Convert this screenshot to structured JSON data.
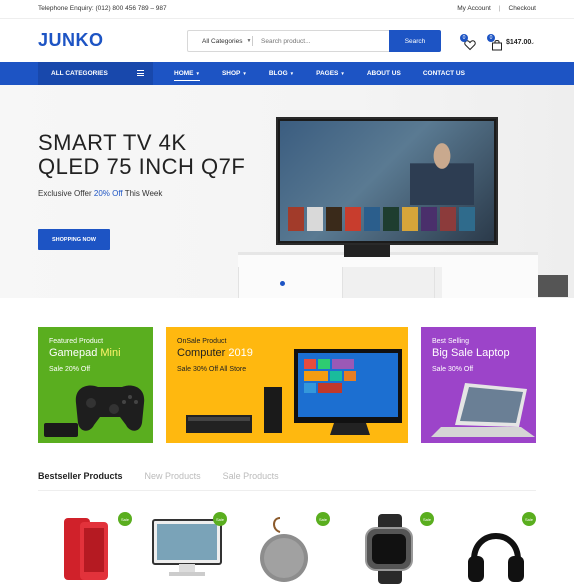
{
  "topbar": {
    "enquiry": "Telephone Enquiry: (012) 800 456 789 – 987",
    "my_account": "My Account",
    "separator": "|",
    "checkout": "Checkout"
  },
  "header": {
    "logo": "JUNKO",
    "category_select": "All Categories",
    "search_placeholder": "Search product...",
    "search_button": "Search",
    "wishlist_count": "0",
    "cart_count": "0",
    "cart_total": "$147.00"
  },
  "nav": {
    "all_categories": "ALL CATEGORIES",
    "items": [
      {
        "label": "HOME",
        "has_dropdown": true,
        "active": true
      },
      {
        "label": "SHOP",
        "has_dropdown": true
      },
      {
        "label": "BLOG",
        "has_dropdown": true
      },
      {
        "label": "PAGES",
        "has_dropdown": true
      },
      {
        "label": "ABOUT US"
      },
      {
        "label": "CONTACT US"
      }
    ]
  },
  "hero": {
    "title_line1": "SMART TV 4K",
    "title_line2": "QLED 75 INCH Q7F",
    "offer_prefix": "Exclusive Offer ",
    "offer_highlight": "20% Off",
    "offer_suffix": " This Week",
    "button": "SHOPPING NOW"
  },
  "banners": [
    {
      "kicker": "Featured Product",
      "title": "Gamepad ",
      "title_accent": "Mini",
      "sale": "Sale 20% Off",
      "color": "#5aae1f"
    },
    {
      "kicker": "OnSale Product",
      "title": "Computer ",
      "title_accent": "2019",
      "sale": "Sale 30% Off All Store",
      "color": "#ffb80f"
    },
    {
      "kicker": "Best Selling",
      "title": "Big Sale Laptop",
      "title_accent": "",
      "sale": "Sale 30% Off",
      "color": "#9c44c9"
    }
  ],
  "tabs": [
    "Bestseller Products",
    "New Products",
    "Sale Products"
  ],
  "products": [
    {
      "icon": "red-smartphone-icon",
      "badge": "Sale"
    },
    {
      "icon": "monitor-icon",
      "badge": "Sale"
    },
    {
      "icon": "speaker-icon",
      "badge": "Sale"
    },
    {
      "icon": "smartwatch-icon",
      "badge": "Sale"
    },
    {
      "icon": "headphones-icon",
      "badge": "Sale"
    }
  ],
  "colors": {
    "accent": "#1d54c4",
    "green": "#5aae1f",
    "yellow": "#ffb80f",
    "purple": "#9c44c9"
  }
}
